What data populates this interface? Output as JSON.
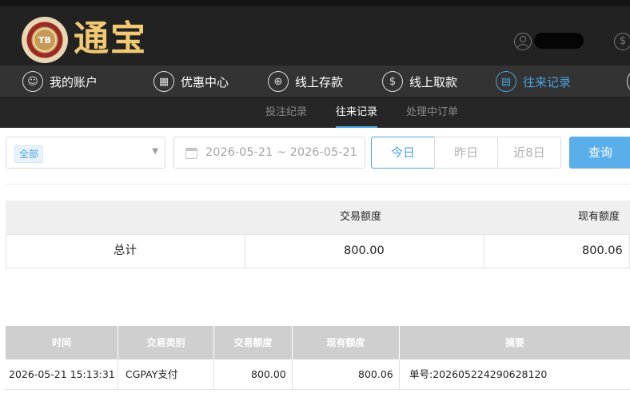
{
  "header": {
    "logo_badge": "TB",
    "logo_text": "通宝"
  },
  "nav": {
    "items": [
      {
        "label": "我的账户",
        "icon": "user-icon"
      },
      {
        "label": "优惠中心",
        "icon": "gift-icon"
      },
      {
        "label": "线上存款",
        "icon": "deposit-icon"
      },
      {
        "label": "线上取款",
        "icon": "withdraw-icon"
      },
      {
        "label": "往来记录",
        "icon": "record-icon",
        "active": true
      }
    ]
  },
  "subnav": {
    "items": [
      {
        "label": "投注纪录"
      },
      {
        "label": "往来记录",
        "active": true
      },
      {
        "label": "处理中订单"
      }
    ]
  },
  "filters": {
    "type_selected": "全部",
    "date_range": "2026-05-21 ~ 2026-05-21",
    "quick": [
      "今日",
      "昨日",
      "近8日"
    ],
    "query_label": "查询"
  },
  "summary": {
    "headers": [
      "交易额度",
      "现有额度"
    ],
    "row": {
      "label": "总计",
      "amount": "800.00",
      "balance": "800.06"
    }
  },
  "details": {
    "headers": [
      "时间",
      "交易类别",
      "交易额度",
      "现有额度",
      "摘要"
    ],
    "rows": [
      [
        "2026-05-21 15:13:31",
        "CGPAY支付",
        "800.00",
        "800.06",
        "单号:202605224290628120"
      ]
    ]
  },
  "colors": {
    "accent": "#4aa3df",
    "gold": "#f1c972",
    "header_bg": "#222222",
    "nav_bg": "#333333"
  }
}
